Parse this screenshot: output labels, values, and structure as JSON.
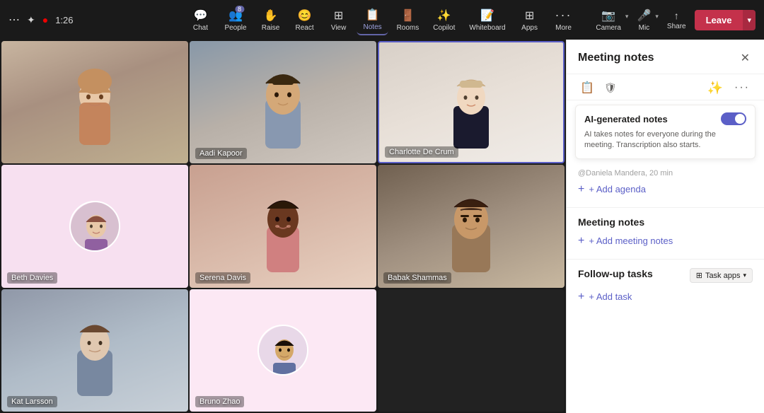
{
  "topbar": {
    "timer": "1:26",
    "nav_items": [
      {
        "id": "chat",
        "label": "Chat",
        "icon": "💬",
        "active": false,
        "badge": null
      },
      {
        "id": "people",
        "label": "People",
        "icon": "👥",
        "active": false,
        "badge": "8"
      },
      {
        "id": "raise",
        "label": "Raise",
        "icon": "✋",
        "active": false,
        "badge": null
      },
      {
        "id": "react",
        "label": "React",
        "icon": "😊",
        "active": false,
        "badge": null
      },
      {
        "id": "view",
        "label": "View",
        "icon": "⊞",
        "active": false,
        "badge": null
      },
      {
        "id": "notes",
        "label": "Notes",
        "icon": "📋",
        "active": true,
        "badge": null
      },
      {
        "id": "rooms",
        "label": "Rooms",
        "icon": "🚪",
        "active": false,
        "badge": null
      },
      {
        "id": "copilot",
        "label": "Copilot",
        "icon": "✨",
        "active": false,
        "badge": null
      },
      {
        "id": "whiteboard",
        "label": "Whiteboard",
        "icon": "📝",
        "active": false,
        "badge": null
      },
      {
        "id": "apps",
        "label": "Apps",
        "icon": "⊞",
        "active": false,
        "badge": null
      },
      {
        "id": "more",
        "label": "More",
        "icon": "···",
        "active": false,
        "badge": null
      }
    ],
    "controls": [
      {
        "id": "camera",
        "label": "Camera",
        "icon": "📷"
      },
      {
        "id": "mic",
        "label": "Mic",
        "icon": "🎤"
      },
      {
        "id": "share",
        "label": "Share",
        "icon": "↑"
      }
    ],
    "leave_label": "Leave"
  },
  "participants": [
    {
      "id": "p1",
      "name": "",
      "row": 0,
      "col": 0,
      "has_avatar": false,
      "bg": "#b8a898"
    },
    {
      "id": "p2",
      "name": "Aadi Kapoor",
      "row": 0,
      "col": 1,
      "has_avatar": false,
      "bg": "#a0a8b0"
    },
    {
      "id": "p3",
      "name": "Charlotte De Crum",
      "row": 0,
      "col": 2,
      "has_avatar": false,
      "bg": "#d0c8c0",
      "active": true
    },
    {
      "id": "p4",
      "name": "Beth Davies",
      "row": 1,
      "col": 0,
      "has_avatar": true,
      "bg": "#f0d6e8"
    },
    {
      "id": "p5",
      "name": "Serena Davis",
      "row": 1,
      "col": 1,
      "has_avatar": false,
      "bg": "#c8a898"
    },
    {
      "id": "p6",
      "name": "Babak Shammas",
      "row": 1,
      "col": 2,
      "has_avatar": false,
      "bg": "#a89080"
    },
    {
      "id": "p7",
      "name": "Kat Larsson",
      "row": 2,
      "col": 0,
      "has_avatar": false,
      "bg": "#b8c0c8"
    },
    {
      "id": "p8",
      "name": "Bruno Zhao",
      "row": 2,
      "col": 1,
      "has_avatar": true,
      "bg": "#fce8f4"
    }
  ],
  "side_panel": {
    "title": "Meeting notes",
    "close_icon": "✕",
    "more_icon": "···",
    "sparkle_icon": "✨",
    "ai_notes": {
      "label": "AI-generated notes",
      "description": "AI takes notes for everyone during the meeting. Transcription also starts.",
      "enabled": true
    },
    "agenda_hint": "@Daniela Mandera, 20 min",
    "add_agenda_label": "+ Add agenda",
    "notes_section_title": "Meeting notes",
    "add_notes_label": "+ Add meeting notes",
    "tasks_section_title": "Follow-up tasks",
    "task_apps_label": "Task apps",
    "add_task_label": "+ Add task"
  }
}
